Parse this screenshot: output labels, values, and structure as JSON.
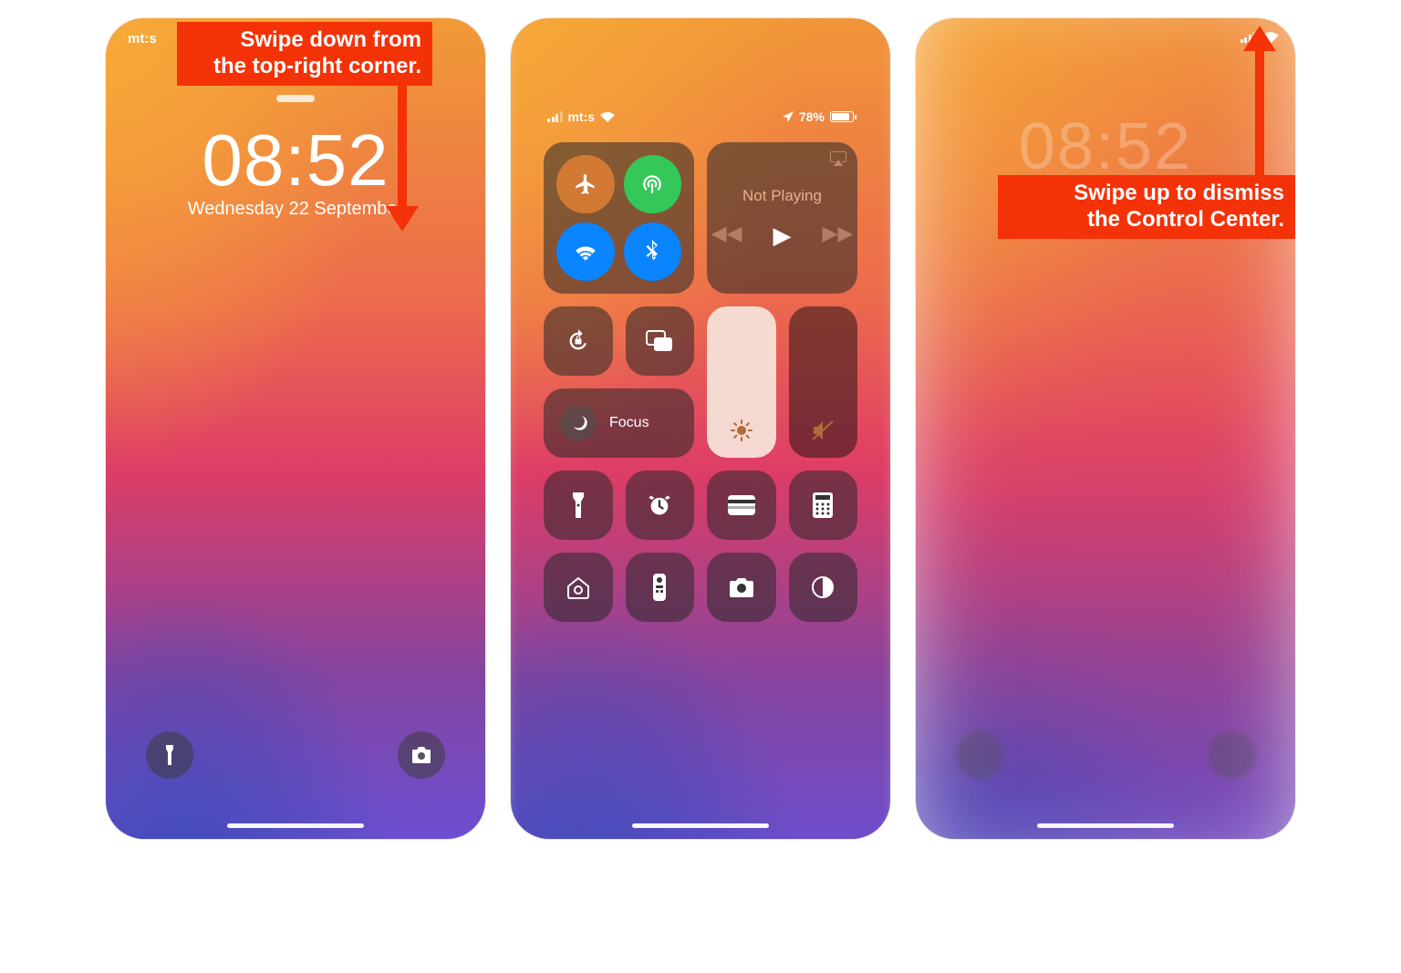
{
  "panel1": {
    "carrier": "mt:s",
    "time": "08:52",
    "date": "Wednesday 22 September",
    "callout": "Swipe down from\nthe top-right corner."
  },
  "panel2": {
    "status": {
      "carrier": "mt:s",
      "battery_pct": "78%"
    },
    "connectivity": {
      "airplane": {
        "on": true,
        "color": "#d27a34"
      },
      "cellular": {
        "on": true,
        "color": "#34c759"
      },
      "wifi": {
        "on": true,
        "color": "#0a84ff"
      },
      "bluetooth": {
        "on": true,
        "color": "#0a84ff"
      }
    },
    "media": {
      "track": "Not Playing"
    },
    "focus_label": "Focus",
    "shortcuts": [
      "flashlight",
      "timer",
      "wallet",
      "calculator",
      "home",
      "remote",
      "camera",
      "dark-mode"
    ]
  },
  "panel3": {
    "blurred_time": "08:52",
    "callout": "Swipe up to dismiss\nthe Control Center."
  }
}
